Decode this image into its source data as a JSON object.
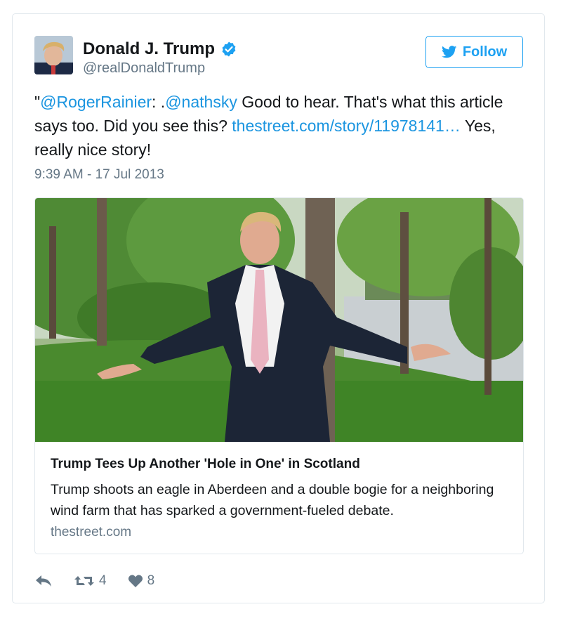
{
  "author": {
    "name": "Donald J. Trump",
    "handle": "@realDonaldTrump",
    "verified": true
  },
  "follow_button": {
    "label": "Follow",
    "icon": "twitter-bird-icon"
  },
  "tweet": {
    "quote_open": "\"",
    "mention1": "@RogerRainier",
    "text1": ": .",
    "mention2": "@nathsky",
    "text2": " Good to hear. That's what this article says too. Did you see this? ",
    "link": "thestreet.com/story/11978141…",
    "text3": " Yes, really nice story!",
    "timestamp": "9:39 AM - 17 Jul 2013"
  },
  "link_card": {
    "title": "Trump Tees Up Another 'Hole in One' in Scotland",
    "description": "Trump shoots an eagle in Aberdeen and a double bogie for a neighboring wind farm that has sparked a government-fueled debate.",
    "domain": "thestreet.com"
  },
  "actions": {
    "reply_icon": "reply-icon",
    "retweet_icon": "retweet-icon",
    "retweet_count": "4",
    "like_icon": "heart-icon",
    "like_count": "8"
  },
  "colors": {
    "link": "#1b95e0",
    "follow": "#1da1f2",
    "muted": "#657786",
    "border": "#e1e8ed"
  }
}
